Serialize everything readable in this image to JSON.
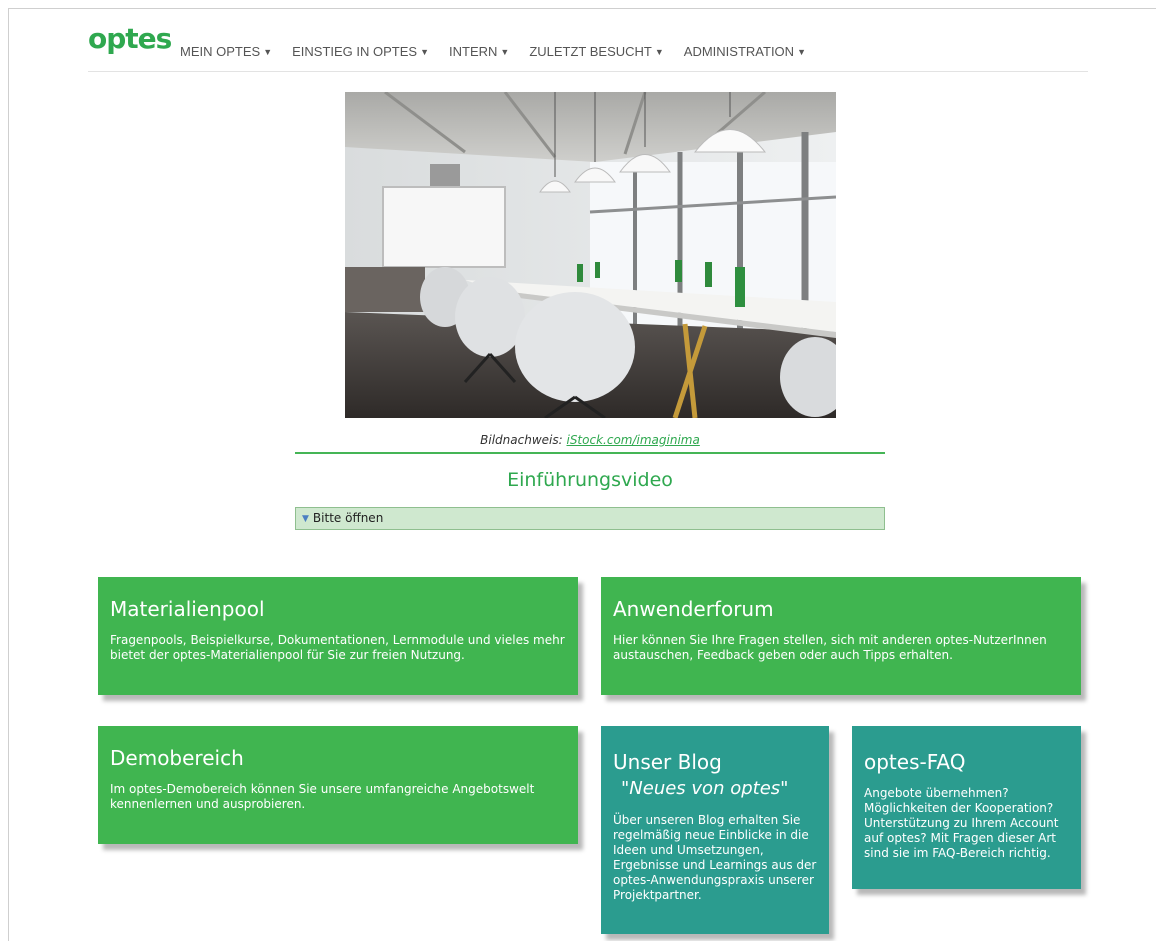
{
  "logo": "optes",
  "nav": {
    "items": [
      {
        "label": "MEIN OPTES"
      },
      {
        "label": "EINSTIEG IN OPTES"
      },
      {
        "label": "INTERN"
      },
      {
        "label": "ZULETZT BESUCHT"
      },
      {
        "label": "ADMINISTRATION"
      }
    ]
  },
  "hero": {
    "credit_prefix": "Bildnachweis: ",
    "credit_link": "iStock.com/imaginima"
  },
  "video": {
    "title": "Einführungsvideo",
    "accordion_label": "Bitte öffnen"
  },
  "tiles": {
    "materialienpool": {
      "title": "Materialienpool",
      "text": "Fragenpools, Beispielkurse, Dokumentationen, Lernmodule und vieles mehr bietet der optes-Materialienpool für Sie zur freien Nutzung."
    },
    "anwenderforum": {
      "title": "Anwenderforum",
      "text": "Hier können Sie Ihre Fragen stellen, sich mit anderen optes-NutzerInnen austauschen, Feedback geben oder auch Tipps erhalten."
    },
    "demobereich": {
      "title": "Demobereich",
      "text": "Im optes-Demobereich können Sie unsere umfangreiche Angebotswelt kennenlernen und ausprobieren."
    },
    "blog": {
      "title": "Unser Blog",
      "subtitle": "\"Neues von optes\"",
      "text": "Über unseren Blog erhalten Sie regelmäßig neue Einblicke in die Ideen und Umsetzungen, Ergebnisse und Learnings aus der optes-Anwendungspraxis unserer Projektpartner."
    },
    "faq": {
      "title": "optes-FAQ",
      "text": "Angebote übernehmen? Möglichkeiten der Kooperation? Unterstützung zu Ihrem Account auf optes? Mit Fragen dieser Art sind sie im FAQ-Bereich richtig."
    }
  },
  "colors": {
    "brand_green": "#2fa84f",
    "tile_green": "#40b550",
    "tile_teal": "#2b9c8f"
  }
}
